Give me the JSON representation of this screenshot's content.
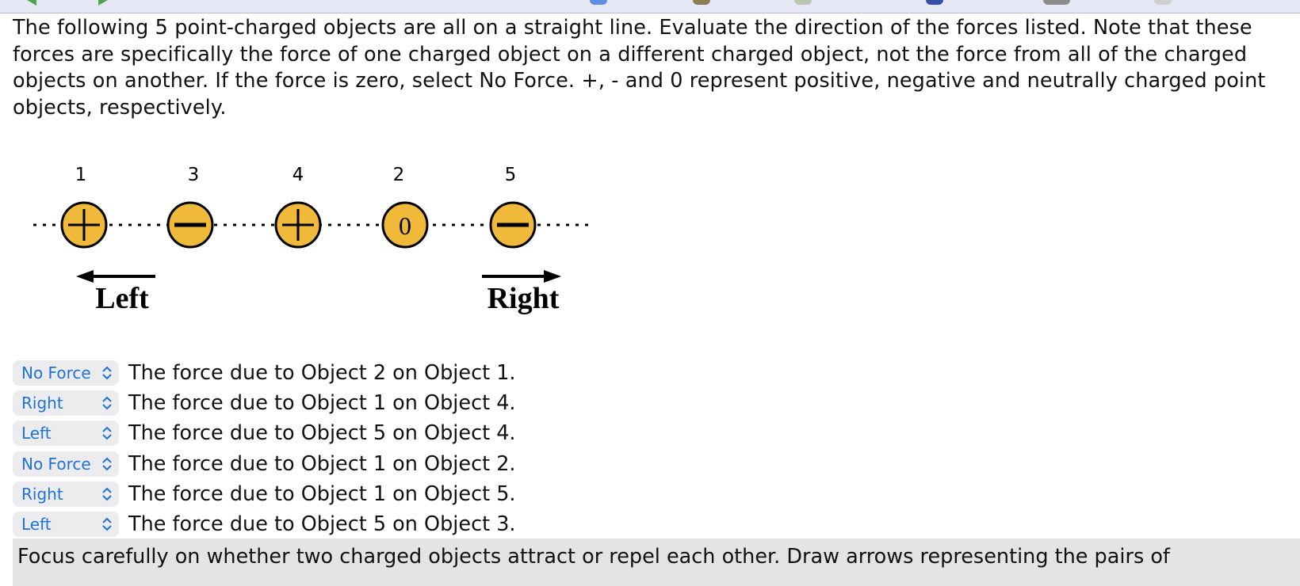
{
  "toolbar": {
    "icons": [
      "back-arrow-icon",
      "forward-arrow-icon",
      "circle-icon",
      "folder-icon",
      "document-icon",
      "book-icon",
      "disc-icon",
      "page-icon"
    ]
  },
  "problem": {
    "intro": "The following 5 point-charged objects are all on a straight line. Evaluate the direction of the forces listed. Note that these forces are specifically the force of one charged object on a different charged object, not the force from all of the charged objects on another. If the force is zero, select No Force. +, - and 0 represent positive, negative and neutrally charged point objects, respectively."
  },
  "diagram": {
    "objects": [
      {
        "label": "1",
        "charge": "+"
      },
      {
        "label": "3",
        "charge": "-"
      },
      {
        "label": "4",
        "charge": "+"
      },
      {
        "label": "2",
        "charge": "0"
      },
      {
        "label": "5",
        "charge": "-"
      }
    ],
    "left_label": "Left",
    "right_label": "Right",
    "colors": {
      "charge_fill": "#f0b93a",
      "outline": "#000000"
    }
  },
  "questions": [
    {
      "answer": "No Force",
      "text": "The force due to Object 2 on Object 1."
    },
    {
      "answer": "Right",
      "text": "The force due to Object 1 on Object 4."
    },
    {
      "answer": "Left",
      "text": "The force due to Object 5 on Object 4."
    },
    {
      "answer": "No Force",
      "text": "The force due to Object 1 on Object 2."
    },
    {
      "answer": "Right",
      "text": "The force due to Object 1 on Object 5."
    },
    {
      "answer": "Left",
      "text": "The force due to Object 5 on Object 3."
    }
  ],
  "feedback": {
    "text": "Focus carefully on whether two charged objects attract or repel each other. Draw arrows representing the pairs of"
  },
  "colors": {
    "select_text": "#1e73d8",
    "select_bg": "#ececee",
    "feedback_bg": "#e4e4e6"
  }
}
